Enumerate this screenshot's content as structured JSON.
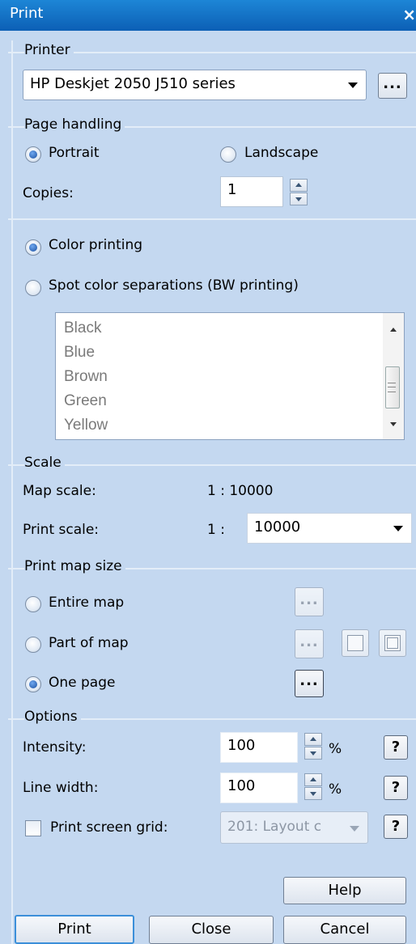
{
  "window": {
    "title": "Print",
    "close_glyph": "×"
  },
  "printer": {
    "legend": "Printer",
    "selected": "HP Deskjet 2050 J510 series",
    "browse_label": "..."
  },
  "page_handling": {
    "legend": "Page handling",
    "portrait_label": "Portrait",
    "landscape_label": "Landscape",
    "orientation": "Portrait",
    "copies_label": "Copies:",
    "copies_value": "1"
  },
  "color": {
    "color_printing_label": "Color printing",
    "spot_label": "Spot color separations (BW printing)",
    "selected": "Color printing",
    "spot_colors": [
      "Black",
      "Blue",
      "Brown",
      "Green",
      "Yellow"
    ]
  },
  "scale": {
    "legend": "Scale",
    "map_scale_label": "Map scale:",
    "map_scale_value": "1 : 10000",
    "print_scale_label": "Print scale:",
    "print_scale_prefix": "1 :",
    "print_scale_value": "10000"
  },
  "print_map_size": {
    "legend": "Print map size",
    "entire_label": "Entire map",
    "part_label": "Part of map",
    "one_page_label": "One page",
    "selected": "One page",
    "dots": "..."
  },
  "options": {
    "legend": "Options",
    "intensity_label": "Intensity:",
    "intensity_value": "100",
    "line_width_label": "Line width:",
    "line_width_value": "100",
    "percent": "%",
    "grid_label": "Print screen grid:",
    "grid_checked": false,
    "grid_value": "201: Layout c",
    "help_glyph": "?"
  },
  "buttons": {
    "help": "Help",
    "print": "Print",
    "close": "Close",
    "cancel": "Cancel"
  },
  "colors": {
    "background": "#c4d8f0",
    "titlebar": "#0c5fb5",
    "default_button_border": "#3b8fd9"
  }
}
